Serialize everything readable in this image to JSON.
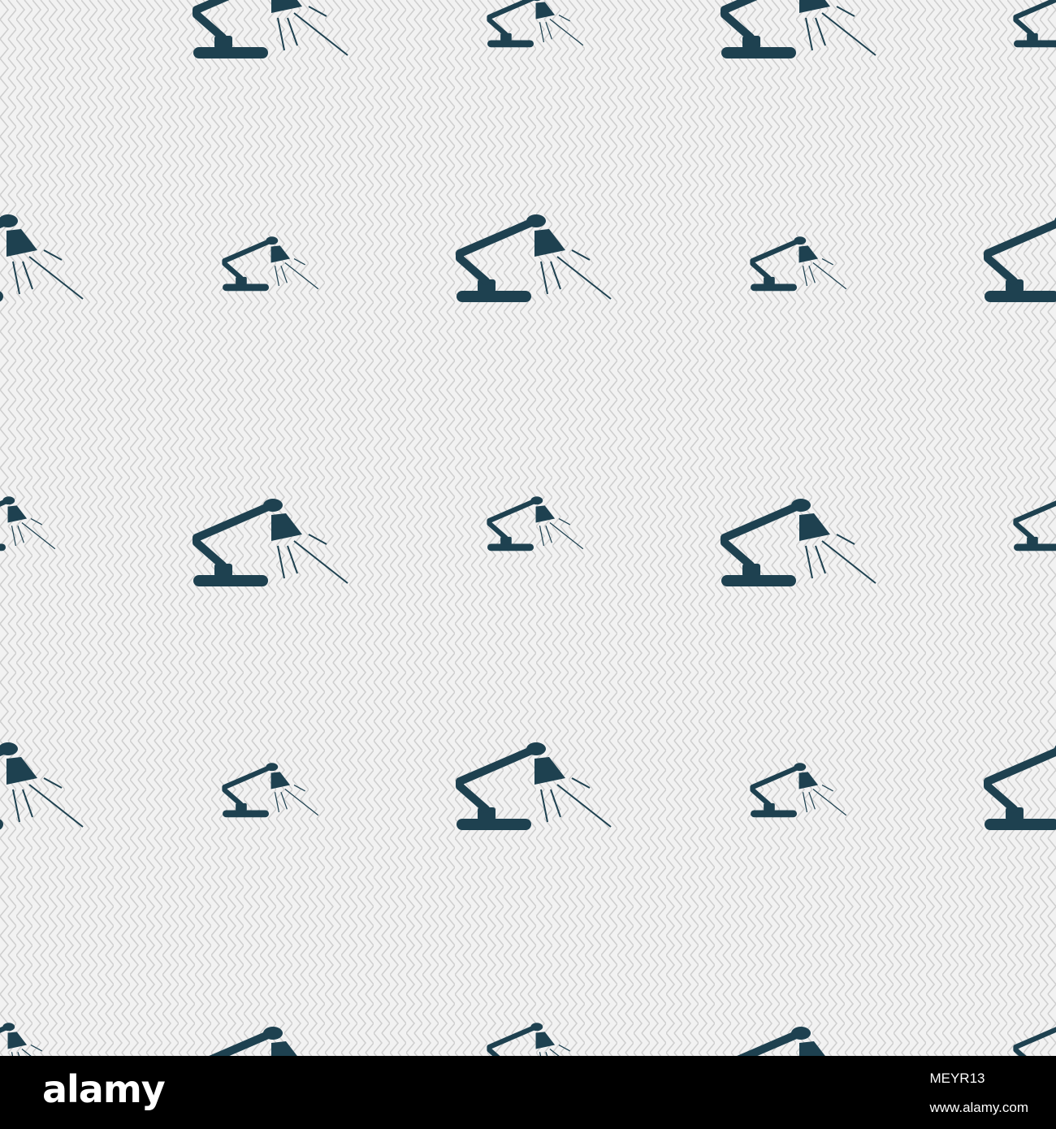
{
  "pattern": {
    "background_color": "#f2f2f2",
    "zigzag_color": "#cfcfcf",
    "icon_color": "#1e4150",
    "icon_name": "desk-lamp-icon"
  },
  "footer": {
    "background_color": "#000000",
    "logo_text": "alamy",
    "id_prefix": "www.alamy.com",
    "image_id": "MEYR13"
  }
}
